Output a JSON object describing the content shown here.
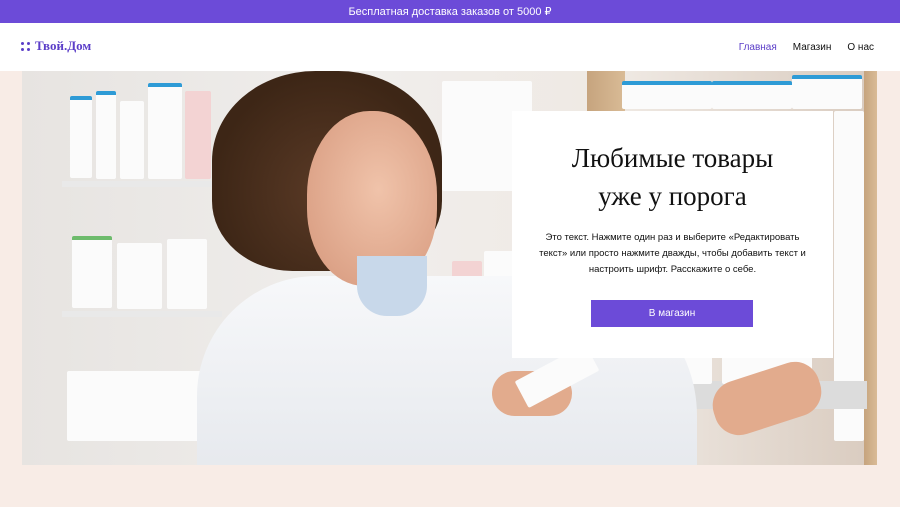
{
  "promo": {
    "text": "Бесплатная доставка заказов от 5000 ₽"
  },
  "header": {
    "logo": "Твой.Дом",
    "nav": [
      "Главная",
      "Магазин",
      "О нас"
    ],
    "active_index": 0
  },
  "hero": {
    "image_alt": "pharmacist at shelves",
    "title": "Любимые товары\nуже у порога",
    "text": "Это текст. Нажмите один раз и выберите «Редактировать текст» или просто нажмите дважды, чтобы добавить текст и настроить шрифт. Расскажите о себе.",
    "button": "В магазин"
  },
  "colors": {
    "accent": "#6c4bd8",
    "logo": "#5b3ec8",
    "page_background": "#f8ece6"
  },
  "icons": {
    "logo": "four-dots-icon"
  }
}
